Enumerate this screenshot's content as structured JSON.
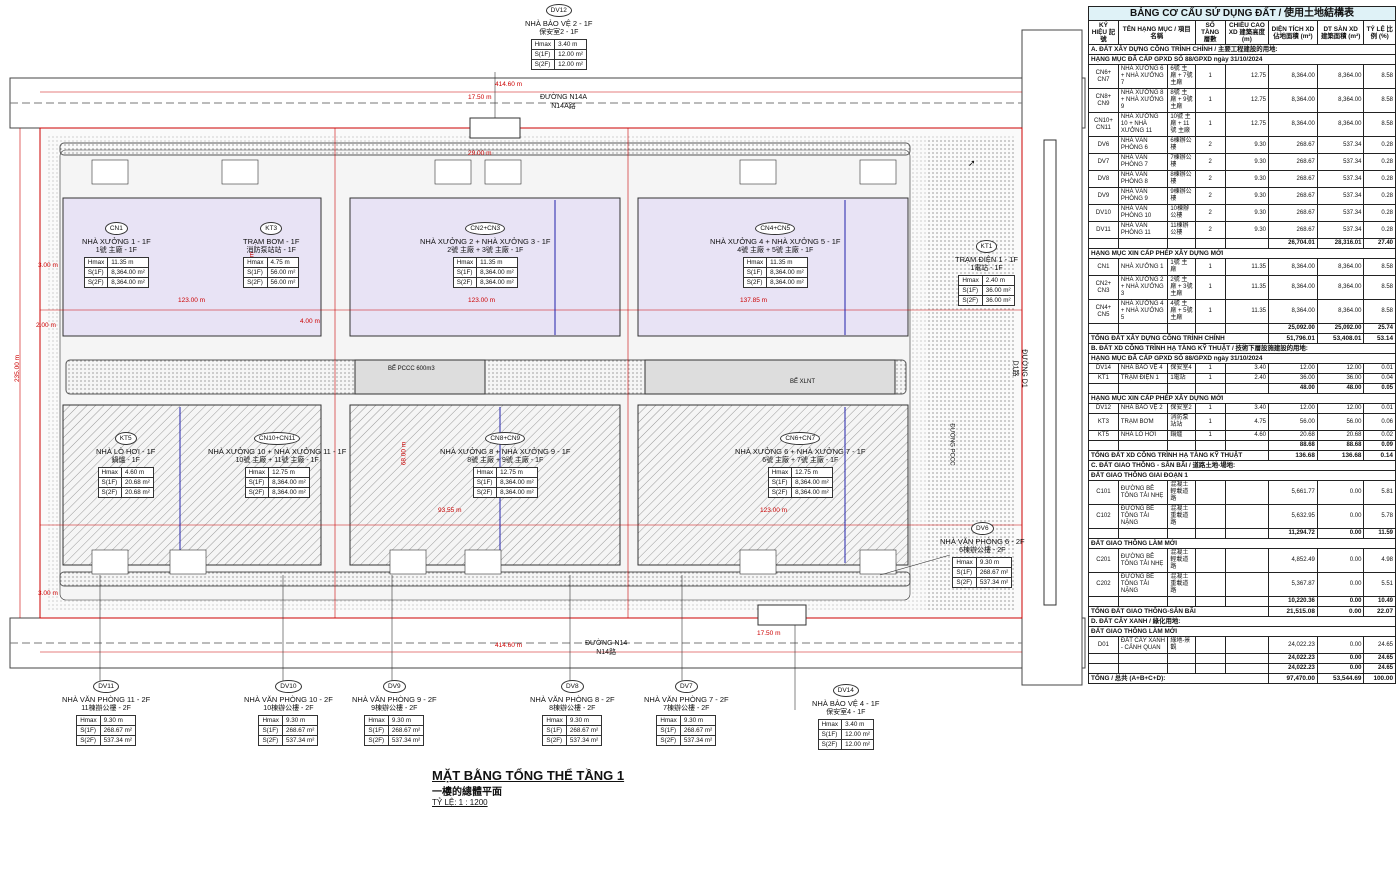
{
  "roads": {
    "north": "ĐƯỜNG N14A",
    "north_cn": "N14A路",
    "south": "ĐƯỜNG N14",
    "south_cn": "N14路",
    "east": "ĐƯỜNG D1",
    "east_cn": "D1路"
  },
  "dimensions": {
    "total_width": "414.60 m",
    "total_height": "235.00 m",
    "gate_north": "17.50 m",
    "gate_south": "17.50 m",
    "a": "123.00 m",
    "b": "137.85 m",
    "c": "68.00 m",
    "d": "29.00 m",
    "e": "93.55 m",
    "f": "2.00 m",
    "g": "4.00 m",
    "h": "3.00 m"
  },
  "buildings": [
    {
      "id": "CN1",
      "name": "NHÀ XƯỞNG 1 - 1F",
      "name_cn": "1號 主廠 - 1F",
      "hmax": "11.35 m",
      "s1": "8,364.00 m²",
      "s2": "8,364.00 m²"
    },
    {
      "id": "KT3",
      "name": "TRẠM BƠM - 1F",
      "name_cn": "消防泵站站 - 1F",
      "hmax": "4.75 m",
      "s1": "56.00 m²",
      "s2": "56.00 m²"
    },
    {
      "id": "CN2+CN3",
      "name": "NHÀ XƯỞNG 2 + NHÀ XƯỞNG 3 - 1F",
      "name_cn": "2號 主廠 + 3號 主廠 - 1F",
      "hmax": "11.35 m",
      "s1": "8,364.00 m²",
      "s2": "8,364.00 m²"
    },
    {
      "id": "CN4+CN5",
      "name": "NHÀ XƯỞNG 4 + NHÀ XƯỞNG 5 - 1F",
      "name_cn": "4號 主廠 + 5號 主廠 - 1F",
      "hmax": "11.35 m",
      "s1": "8,364.00 m²",
      "s2": "8,364.00 m²"
    },
    {
      "id": "KT1",
      "name": "TRẠM ĐIỆN 1 - 1F",
      "name_cn": "1電站 - 1F",
      "hmax": "2.40 m",
      "s1": "36.00 m²",
      "s2": "36.00 m²"
    },
    {
      "id": "KT5",
      "name": "NHÀ LÒ HƠI - 1F",
      "name_cn": "鍋爐 - 1F",
      "hmax": "4.60 m",
      "s1": "20.68 m²",
      "s2": "20.68 m²"
    },
    {
      "id": "CN10+CN11",
      "name": "NHÀ XƯỞNG 10 + NHÀ XƯỞNG 11 - 1F",
      "name_cn": "10號 主廠 + 11號 主廠 - 1F",
      "hmax": "12.75 m",
      "s1": "8,364.00 m²",
      "s2": "8,364.00 m²"
    },
    {
      "id": "CN8+CN9",
      "name": "NHÀ XƯỞNG 8 + NHÀ XƯỞNG 9 - 1F",
      "name_cn": "8號 主廠 + 9號 主廠 - 1F",
      "hmax": "12.75 m",
      "s1": "8,364.00 m²",
      "s2": "8,364.00 m²"
    },
    {
      "id": "CN6+CN7",
      "name": "NHÀ XƯỞNG 6 + NHÀ XƯỞNG 7 - 1F",
      "name_cn": "6號 主廠 + 7號 主廠 - 1F",
      "hmax": "12.75 m",
      "s1": "8,364.00 m²",
      "s2": "8,364.00 m²"
    },
    {
      "id": "DV6",
      "name": "NHÀ VĂN PHÒNG 6 - 2F",
      "name_cn": "6棟辦公樓 - 2F",
      "hmax": "9.30 m",
      "s1": "268.67 m²",
      "s2": "537.34 m²"
    },
    {
      "id": "DV12",
      "name": "NHÀ BẢO VỆ 2 - 1F",
      "name_cn": "保安室2 - 1F",
      "hmax": "3.40 m",
      "s1": "12.00 m²",
      "s2": "12.00 m²"
    },
    {
      "id": "DV11",
      "name": "NHÀ VĂN PHÒNG 11 - 2F",
      "name_cn": "11棟辦公樓 - 2F",
      "hmax": "9.30 m",
      "s1": "268.67 m²",
      "s2": "537.34 m²"
    },
    {
      "id": "DV10",
      "name": "NHÀ VĂN PHÒNG 10 - 2F",
      "name_cn": "10棟辦公樓 - 2F",
      "hmax": "9.30 m",
      "s1": "268.67 m²",
      "s2": "537.34 m²"
    },
    {
      "id": "DV9",
      "name": "NHÀ VĂN PHÒNG 9 - 2F",
      "name_cn": "9棟辦公樓 - 2F",
      "hmax": "9.30 m",
      "s1": "268.67 m²",
      "s2": "537.34 m²"
    },
    {
      "id": "DV8",
      "name": "NHÀ VĂN PHÒNG 8 - 2F",
      "name_cn": "8棟辦公樓 - 2F",
      "hmax": "9.30 m",
      "s1": "268.67 m²",
      "s2": "537.34 m²"
    },
    {
      "id": "DV7",
      "name": "NHÀ VĂN PHÒNG 7 - 2F",
      "name_cn": "7棟辦公樓 - 2F",
      "hmax": "9.30 m",
      "s1": "268.67 m²",
      "s2": "537.34 m²"
    },
    {
      "id": "DV14",
      "name": "NHÀ BẢO VỆ 4 - 1F",
      "name_cn": "保安室4 - 1F",
      "hmax": "3.40 m",
      "s1": "12.00 m²",
      "s2": "12.00 m²"
    }
  ],
  "row_labels": {
    "hmax": "Hmax",
    "s1": "S(1F)",
    "s2": "S(2F)"
  },
  "misc": {
    "pccc": "BỂ PCCC 600m3",
    "xlnt": "BỂ XLNT",
    "fire_lane": "ĐƯỜNG PCCC"
  },
  "title": {
    "main": "MẶT BẰNG TỔNG THỂ TẦNG 1",
    "cn": "一樓的總體平面",
    "scale": "TỶ LỆ: 1 : 1200"
  },
  "table": {
    "title": "BẢNG CƠ CẤU SỬ DỤNG ĐẤT / 使用土地結構表",
    "headers": [
      "KÝ HIỆU 記號",
      "TÊN HẠNG MỤC / 項目名稱",
      "",
      "SỐ TẦNG 層數",
      "CHIỀU CAO XD 建築高度 (m)",
      "DIỆN TÍCH XD 佔地面積 (m²)",
      "DT SÀN XD 建築面積 (m²)",
      "TỶ LỆ 比例 (%)"
    ],
    "rows": [
      {
        "t": "sec",
        "text": "A. ĐẤT XÂY DỰNG CÔNG TRÌNH CHÍNH / 主要工程建設的用地:"
      },
      {
        "t": "sec",
        "text": "HẠNG MỤC ĐÃ CẤP GPXD SỐ 88/GPXD ngày 31/10/2024"
      },
      {
        "t": "r",
        "c": [
          "CN6+ CN7",
          "NHÀ XƯỞNG 6 + NHÀ XƯỞNG 7",
          "6號 主廠 + 7號 主廠",
          "1",
          "12.75",
          "8,364.00",
          "8,364.00",
          "8.58"
        ]
      },
      {
        "t": "r",
        "c": [
          "CN8+ CN9",
          "NHÀ XƯỞNG 8 + NHÀ XƯỞNG 9",
          "8號 主廠 + 9號 主廠",
          "1",
          "12.75",
          "8,364.00",
          "8,364.00",
          "8.58"
        ]
      },
      {
        "t": "r",
        "c": [
          "CN10+ CN11",
          "NHÀ XƯỞNG 10 + NHÀ XƯỞNG 11",
          "10號 主廠 + 11號 主廠",
          "1",
          "12.75",
          "8,364.00",
          "8,364.00",
          "8.58"
        ]
      },
      {
        "t": "r",
        "c": [
          "DV6",
          "NHÀ VĂN PHÒNG 6",
          "6棟辦公樓",
          "2",
          "9.30",
          "268.67",
          "537.34",
          "0.28"
        ]
      },
      {
        "t": "r",
        "c": [
          "DV7",
          "NHÀ VĂN PHÒNG 7",
          "7棟辦公樓",
          "2",
          "9.30",
          "268.67",
          "537.34",
          "0.28"
        ]
      },
      {
        "t": "r",
        "c": [
          "DV8",
          "NHÀ VĂN PHÒNG 8",
          "8棟辦公樓",
          "2",
          "9.30",
          "268.67",
          "537.34",
          "0.28"
        ]
      },
      {
        "t": "r",
        "c": [
          "DV9",
          "NHÀ VĂN PHÒNG 9",
          "9棟辦公樓",
          "2",
          "9.30",
          "268.67",
          "537.34",
          "0.28"
        ]
      },
      {
        "t": "r",
        "c": [
          "DV10",
          "NHÀ VĂN PHÒNG 10",
          "10棟辦公樓",
          "2",
          "9.30",
          "268.67",
          "537.34",
          "0.28"
        ]
      },
      {
        "t": "r",
        "c": [
          "DV11",
          "NHÀ VĂN PHÒNG 11",
          "11棟辦公樓",
          "2",
          "9.30",
          "268.67",
          "537.34",
          "0.28"
        ]
      },
      {
        "t": "tot",
        "c": [
          "",
          "",
          "",
          "",
          "",
          "26,704.01",
          "28,316.01",
          "27.40"
        ]
      },
      {
        "t": "sec",
        "text": "HẠNG MỤC XIN CẤP PHÉP XÂY DỰNG MỚI"
      },
      {
        "t": "r",
        "c": [
          "CN1",
          "NHÀ XƯỞNG 1",
          "1號 主廠",
          "1",
          "11.35",
          "8,364.00",
          "8,364.00",
          "8.58"
        ]
      },
      {
        "t": "r",
        "c": [
          "CN2+ CN3",
          "NHÀ XƯỞNG 2 + NHÀ XƯỞNG 3",
          "2號 主廠 + 3號 主廠",
          "1",
          "11.35",
          "8,364.00",
          "8,364.00",
          "8.58"
        ]
      },
      {
        "t": "r",
        "c": [
          "CN4+ CN5",
          "NHÀ XƯỞNG 4 + NHÀ XƯỞNG 5",
          "4號 主廠 + 5號 主廠",
          "1",
          "11.35",
          "8,364.00",
          "8,364.00",
          "8.58"
        ]
      },
      {
        "t": "tot",
        "c": [
          "",
          "",
          "",
          "",
          "",
          "25,092.00",
          "25,092.00",
          "25.74"
        ]
      },
      {
        "t": "tot2",
        "text": "TỔNG ĐẤT XÂY DỰNG CÔNG TRÌNH CHÍNH",
        "c": [
          "51,796.01",
          "53,408.01",
          "53.14"
        ]
      },
      {
        "t": "sec",
        "text": "B. ĐẤT XD CÔNG TRÌNH HẠ TẦNG KỸ THUẬT / 技術下層設施建設的用地:"
      },
      {
        "t": "sec",
        "text": "HẠNG MỤC ĐÃ CẤP GPXD SỐ 88/GPXD ngày 31/10/2024"
      },
      {
        "t": "r",
        "c": [
          "DV14",
          "NHÀ BẢO VỆ 4",
          "保安室4",
          "1",
          "3.40",
          "12.00",
          "12.00",
          "0.01"
        ]
      },
      {
        "t": "r",
        "c": [
          "KT1",
          "TRẠM ĐIỆN 1",
          "1電站",
          "1",
          "2.40",
          "36.00",
          "36.00",
          "0.04"
        ]
      },
      {
        "t": "tot",
        "c": [
          "",
          "",
          "",
          "",
          "",
          "48.00",
          "48.00",
          "0.05"
        ]
      },
      {
        "t": "sec",
        "text": "HẠNG MỤC XIN CẤP PHÉP XÂY DỰNG MỚI"
      },
      {
        "t": "r",
        "c": [
          "DV12",
          "NHÀ BẢO VỆ 2",
          "保安室2",
          "1",
          "3.40",
          "12.00",
          "12.00",
          "0.01"
        ]
      },
      {
        "t": "r",
        "c": [
          "KT3",
          "TRẠM BƠM",
          "消防泵站站",
          "1",
          "4.75",
          "56.00",
          "56.00",
          "0.06"
        ]
      },
      {
        "t": "r",
        "c": [
          "KT5",
          "NHÀ LÒ HƠI",
          "鍋爐",
          "1",
          "4.60",
          "20.68",
          "20.68",
          "0.02"
        ]
      },
      {
        "t": "tot",
        "c": [
          "",
          "",
          "",
          "",
          "",
          "88.68",
          "88.68",
          "0.09"
        ]
      },
      {
        "t": "tot2",
        "text": "TỔNG ĐẤT XD CÔNG TRÌNH HẠ TẦNG KỸ THUẬT",
        "c": [
          "136.68",
          "136.68",
          "0.14"
        ]
      },
      {
        "t": "sec",
        "text": "C. ĐẤT GIAO THÔNG - SÂN BÃI / 道路土地-場地:"
      },
      {
        "t": "sec",
        "text": "ĐẤT GIAO THÔNG GIAI ĐOẠN 1"
      },
      {
        "t": "r",
        "c": [
          "C101",
          "ĐƯỜNG BÊ TÔNG TẢI NHẸ",
          "混凝土輕載道路",
          "",
          "",
          "5,661.77",
          "0.00",
          "5.81"
        ]
      },
      {
        "t": "r",
        "c": [
          "C102",
          "ĐƯỜNG BÊ TÔNG TẢI NẶNG",
          "混凝土重載道路",
          "",
          "",
          "5,632.95",
          "0.00",
          "5.78"
        ]
      },
      {
        "t": "tot",
        "c": [
          "",
          "",
          "",
          "",
          "",
          "11,294.72",
          "0.00",
          "11.59"
        ]
      },
      {
        "t": "sec",
        "text": "ĐẤT GIAO THÔNG LÀM MỚI"
      },
      {
        "t": "r",
        "c": [
          "C201",
          "ĐƯỜNG BÊ TÔNG TẢI NHẸ",
          "混凝土輕載道路",
          "",
          "",
          "4,852.49",
          "0.00",
          "4.98"
        ]
      },
      {
        "t": "r",
        "c": [
          "C202",
          "ĐƯỜNG BÊ TÔNG TẢI NẶNG",
          "混凝土重載道路",
          "",
          "",
          "5,367.87",
          "0.00",
          "5.51"
        ]
      },
      {
        "t": "tot",
        "c": [
          "",
          "",
          "",
          "",
          "",
          "10,220.36",
          "0.00",
          "10.49"
        ]
      },
      {
        "t": "tot2",
        "text": "TỔNG ĐẤT GIAO THÔNG-SÂN BÃI",
        "c": [
          "21,515.08",
          "0.00",
          "22.07"
        ]
      },
      {
        "t": "sec",
        "text": "D. ĐẤT CÂY XANH / 綠化用地:"
      },
      {
        "t": "sec",
        "text": "ĐẤT GIAO THÔNG LÀM MỚI"
      },
      {
        "t": "r",
        "c": [
          "D01",
          "ĐẤT CÂY XANH - CẢNH QUAN",
          "綠地-景觀",
          "",
          "",
          "24,022.23",
          "0.00",
          "24.65"
        ]
      },
      {
        "t": "tot",
        "c": [
          "",
          "",
          "",
          "",
          "",
          "24,022.23",
          "0.00",
          "24.65"
        ]
      },
      {
        "t": "tot",
        "c": [
          "",
          "",
          "",
          "",
          "",
          "24,022.23",
          "0.00",
          "24.65"
        ]
      },
      {
        "t": "tot2",
        "text": "TỔNG / 总共 (A+B+C+D):",
        "c": [
          "97,470.00",
          "53,544.69",
          "100.00"
        ]
      }
    ]
  }
}
